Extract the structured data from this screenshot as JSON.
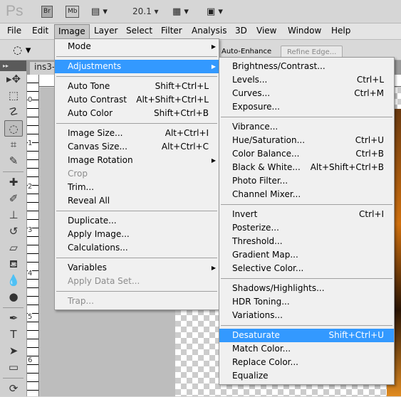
{
  "app": {
    "logo": "Ps",
    "bridge": "Br",
    "minibridge": "Mb",
    "zoom": "20.1"
  },
  "menubar": [
    "File",
    "Edit",
    "Image",
    "Layer",
    "Select",
    "Filter",
    "Analysis",
    "3D",
    "View",
    "Window",
    "Help"
  ],
  "options": {
    "auto_enhance": "Auto-Enhance",
    "refine_edge": "Refine Edge..."
  },
  "document_tab": "ins3-",
  "ruler": {
    "vertical": [
      "0",
      "1",
      "2",
      "3",
      "4",
      "5",
      "6"
    ]
  },
  "image_menu": [
    {
      "label": "Mode",
      "sub": true
    },
    {
      "sep": true
    },
    {
      "label": "Adjustments",
      "sub": true,
      "highlight": true
    },
    {
      "sep": true
    },
    {
      "label": "Auto Tone",
      "shortcut": "Shift+Ctrl+L"
    },
    {
      "label": "Auto Contrast",
      "shortcut": "Alt+Shift+Ctrl+L"
    },
    {
      "label": "Auto Color",
      "shortcut": "Shift+Ctrl+B"
    },
    {
      "sep": true
    },
    {
      "label": "Image Size...",
      "shortcut": "Alt+Ctrl+I"
    },
    {
      "label": "Canvas Size...",
      "shortcut": "Alt+Ctrl+C"
    },
    {
      "label": "Image Rotation",
      "sub": true
    },
    {
      "label": "Crop",
      "disabled": true
    },
    {
      "label": "Trim..."
    },
    {
      "label": "Reveal All"
    },
    {
      "sep": true
    },
    {
      "label": "Duplicate..."
    },
    {
      "label": "Apply Image..."
    },
    {
      "label": "Calculations..."
    },
    {
      "sep": true
    },
    {
      "label": "Variables",
      "sub": true
    },
    {
      "label": "Apply Data Set...",
      "disabled": true
    },
    {
      "sep": true
    },
    {
      "label": "Trap...",
      "disabled": true
    }
  ],
  "adjustments_menu": [
    {
      "label": "Brightness/Contrast..."
    },
    {
      "label": "Levels...",
      "shortcut": "Ctrl+L"
    },
    {
      "label": "Curves...",
      "shortcut": "Ctrl+M"
    },
    {
      "label": "Exposure..."
    },
    {
      "sep": true
    },
    {
      "label": "Vibrance..."
    },
    {
      "label": "Hue/Saturation...",
      "shortcut": "Ctrl+U"
    },
    {
      "label": "Color Balance...",
      "shortcut": "Ctrl+B"
    },
    {
      "label": "Black & White...",
      "shortcut": "Alt+Shift+Ctrl+B"
    },
    {
      "label": "Photo Filter..."
    },
    {
      "label": "Channel Mixer..."
    },
    {
      "sep": true
    },
    {
      "label": "Invert",
      "shortcut": "Ctrl+I"
    },
    {
      "label": "Posterize..."
    },
    {
      "label": "Threshold..."
    },
    {
      "label": "Gradient Map..."
    },
    {
      "label": "Selective Color..."
    },
    {
      "sep": true
    },
    {
      "label": "Shadows/Highlights..."
    },
    {
      "label": "HDR Toning..."
    },
    {
      "label": "Variations..."
    },
    {
      "sep": true
    },
    {
      "label": "Desaturate",
      "shortcut": "Shift+Ctrl+U",
      "highlight": true
    },
    {
      "label": "Match Color..."
    },
    {
      "label": "Replace Color..."
    },
    {
      "label": "Equalize"
    }
  ],
  "tools": [
    "move-tool",
    "marquee-tool",
    "lasso-tool",
    "quick-selection-tool",
    "crop-tool",
    "eyedropper-tool",
    "|",
    "healing-brush-tool",
    "brush-tool",
    "clone-stamp-tool",
    "history-brush-tool",
    "eraser-tool",
    "paint-bucket-tool",
    "blur-tool",
    "dodge-tool",
    "|",
    "pen-tool",
    "type-tool",
    "path-selection-tool",
    "rectangle-tool",
    "|",
    "3d-rotate-tool"
  ],
  "colors": {
    "highlight": "#3399ff",
    "menu_bg": "#f0f0f0"
  }
}
